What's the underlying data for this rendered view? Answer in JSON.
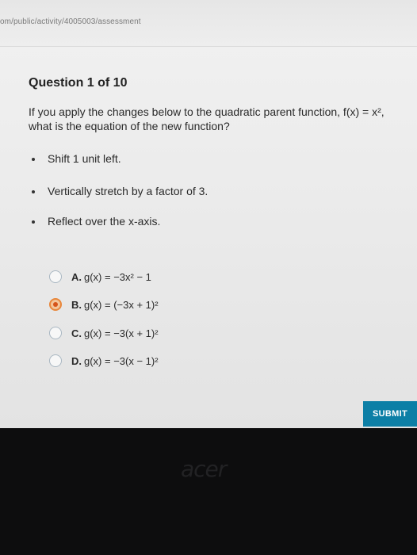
{
  "browser": {
    "url": "om/public/activity/4005003/assessment"
  },
  "question": {
    "title": "Question 1 of 10",
    "prompt_line1": "If you apply the changes below to the quadratic parent function, f(x) = x²,",
    "prompt_line2": "what is the equation of the new function?",
    "bullets": [
      "Shift 1 unit left.",
      "Vertically stretch by a factor of 3.",
      "Reflect over the x-axis."
    ]
  },
  "options": [
    {
      "letter": "A.",
      "text": "g(x) = −3x² − 1",
      "selected": false
    },
    {
      "letter": "B.",
      "text": "g(x) = (−3x + 1)²",
      "selected": true
    },
    {
      "letter": "C.",
      "text": "g(x) = −3(x + 1)²",
      "selected": false
    },
    {
      "letter": "D.",
      "text": "g(x) = −3(x − 1)²",
      "selected": false
    }
  ],
  "submit_label": "SUBMIT",
  "device": {
    "brand": "acer"
  },
  "colors": {
    "selected_radio": "#e8863a",
    "submit_bg": "#0c7fa6"
  }
}
